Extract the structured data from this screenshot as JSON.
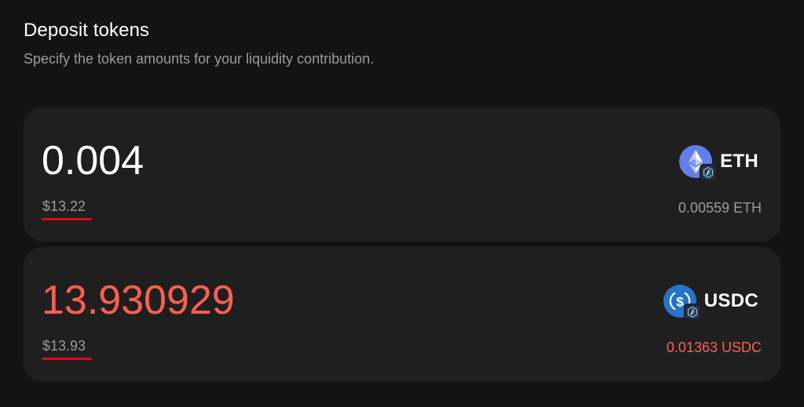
{
  "header": {
    "title": "Deposit tokens",
    "subtitle": "Specify the token amounts for your liquidity contribution."
  },
  "deposits": [
    {
      "amount": "0.004",
      "usd_value": "$13.22",
      "token_symbol": "ETH",
      "token_icon": "eth-icon",
      "chain_badge": "arbitrum-icon",
      "balance": "0.00559 ETH",
      "amount_state": "normal"
    },
    {
      "amount": "13.930929",
      "usd_value": "$13.93",
      "token_symbol": "USDC",
      "token_icon": "usdc-icon",
      "chain_badge": "arbitrum-icon",
      "balance": "0.01363 USDC",
      "amount_state": "insufficient-balance"
    }
  ],
  "colors": {
    "background": "#131313",
    "card": "#1f1f1f",
    "text_primary": "#ffffff",
    "text_secondary": "#9b9b9b",
    "error": "#ff5f52",
    "underline": "#e50914",
    "eth": "#627eea",
    "usdc": "#2775ca"
  }
}
